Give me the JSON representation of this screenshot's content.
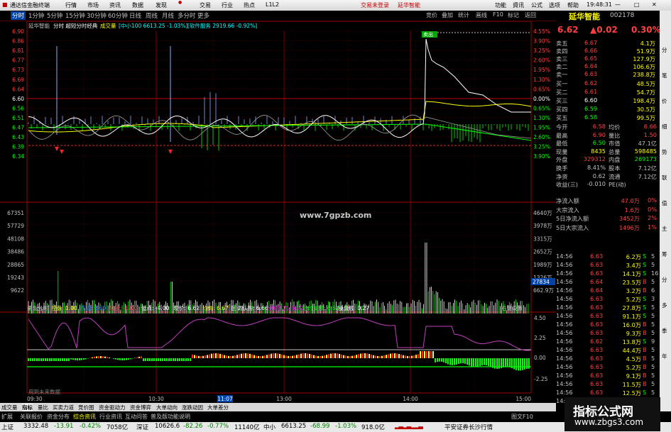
{
  "titlebar": {
    "app": "通达信金融终端",
    "menus": [
      "行情",
      "市场",
      "资讯",
      "数据",
      "发现",
      "交易",
      "行业",
      "热点",
      "L1L2"
    ],
    "trade_links": [
      "交易未登录",
      "延华智能"
    ],
    "right_menus": [
      "功能",
      "資讯",
      "公式",
      "选项",
      "帮助"
    ],
    "time": "19:48:31"
  },
  "tabs": {
    "periods": [
      "分时",
      "1分钟",
      "5分钟",
      "15分钟",
      "30分钟",
      "60分钟",
      "日线",
      "周线",
      "月线",
      "多分时",
      "更多"
    ],
    "active": "分时",
    "buttons": [
      "竞价",
      "叠加",
      "统计",
      "画线",
      "F10",
      "标记",
      "返回"
    ]
  },
  "chart": {
    "header": {
      "name": "延华智能",
      "mode": "分时 超短分时经典",
      "vol_label": "成交量",
      "index_info": "[中小100 6613.25 -1.03%]",
      "sector_info": "[软件服务 2919.66 -0.92%]"
    },
    "price_ticks": [
      "6.90",
      "6.86",
      "6.81",
      "6.77",
      "6.73",
      "6.69",
      "6.64",
      "6.60",
      "6.56",
      "6.51",
      "6.47",
      "6.43",
      "6.39",
      "6.34"
    ],
    "pct_ticks": [
      "4.55%",
      "3.90%",
      "3.25%",
      "2.60%",
      "1.95%",
      "1.30%",
      "0.65%",
      "0.00%",
      "0.65%",
      "1.30%",
      "1.95%",
      "2.60%",
      "3.25%",
      "3.90%"
    ],
    "vol_ticks": [
      "67351",
      "57729",
      "48108",
      "38486",
      "28865",
      "19243",
      "9622"
    ],
    "vol_right_ticks": [
      "4640万",
      "3978万",
      "3315万",
      "2652万",
      "1989万",
      "1326万",
      "662.9万"
    ],
    "vol_highlight": "27834",
    "watermark": "www.7gpzb.com",
    "marker_label": "卖出",
    "indicator": {
      "name": "量能分时",
      "items": [
        {
          "label": "控盘: 1.00",
          "color": "#ffff00"
        },
        {
          "label": "底点: 5.00",
          "color": "#0080ff"
        },
        {
          "label": "风险: -1.00",
          "color": "#ff4040"
        },
        {
          "label": "低点: -4.00",
          "color": "#ffffff"
        },
        {
          "label": "现价: 6.62",
          "color": "#ffffff"
        },
        {
          "label": "均价: 6.67",
          "color": "#ffff00"
        },
        {
          "label": "回调认购: 6.66",
          "color": "#ffffff"
        },
        {
          "label": "分时压力: 6.71",
          "color": "#ff00ff"
        },
        {
          "label": "分时支撑: 6.62",
          "color": "#00ff00"
        },
        {
          "label": "操盘线: 0.27",
          "color": "#ffffff"
        }
      ],
      "settings": "右键设置",
      "ticks": [
        "4.50",
        "2.25",
        "0.00",
        "-2.25"
      ],
      "footnote": "用到未来数据"
    },
    "time_ticks": [
      "09:30",
      "10:30",
      "11:07",
      "13:00",
      "14:00",
      "15:00"
    ]
  },
  "bottom_tabs": [
    "成交量",
    "指标",
    "量比",
    "买卖力道",
    "竞价图",
    "资金驱动力",
    "资金博弈",
    "大单动向",
    "涨跌动因",
    "大单差分"
  ],
  "bottom_links": [
    "扩展",
    "关联报价",
    "资金分布",
    "综合资讯",
    "行业资讯",
    "互动问答",
    "普及版功能说明"
  ],
  "status": {
    "sh": {
      "name": "上证",
      "value": "3332.48",
      "chg": "-13.91",
      "pct": "-0.42%",
      "amt": "7058亿"
    },
    "sz": {
      "name": "深证",
      "value": "10626.6",
      "chg": "-82.26",
      "pct": "-0.77%",
      "amt": "11140亿"
    },
    "zx": {
      "name": "中小",
      "value": "6613.25",
      "chg": "-68.99",
      "pct": "-1.03%",
      "amt": "918.0亿"
    },
    "broker": "平安证券长沙行情",
    "f10": "图文F10"
  },
  "quote": {
    "name": "延华智能",
    "code": "002178",
    "price": "6.62",
    "chg": "▲0.02",
    "pct": "0.30%",
    "asks": [
      {
        "label": "卖五",
        "price": "6.67",
        "vol": "4.1万"
      },
      {
        "label": "卖四",
        "price": "6.66",
        "vol": "51.9万"
      },
      {
        "label": "卖三",
        "price": "6.65",
        "vol": "127.9万"
      },
      {
        "label": "卖二",
        "price": "6.64",
        "vol": "106.6万"
      },
      {
        "label": "卖一",
        "price": "6.63",
        "vol": "238.8万"
      }
    ],
    "bids": [
      {
        "label": "买一",
        "price": "6.62",
        "vol": "48.5万"
      },
      {
        "label": "买二",
        "price": "6.61",
        "vol": "54.7万"
      },
      {
        "label": "买三",
        "price": "6.60",
        "vol": "198.4万"
      },
      {
        "label": "买四",
        "price": "6.59",
        "vol": "30.5万"
      },
      {
        "label": "买五",
        "price": "6.58",
        "vol": "99.5万"
      }
    ],
    "stats": [
      {
        "l1": "今开",
        "v1": "6.58",
        "c1": "#ff4040",
        "l2": "均价",
        "v2": "6.66",
        "c2": "#ff4040"
      },
      {
        "l1": "最高",
        "v1": "6.90",
        "c1": "#ff4040",
        "l2": "量比",
        "v2": "1.50",
        "c2": "#ff4040"
      },
      {
        "l1": "最低",
        "v1": "6.50",
        "c1": "#00ff00",
        "l2": "市值",
        "v2": "47.1亿",
        "c2": "#c0c0c0"
      },
      {
        "l1": "现量",
        "v1": "8435",
        "c1": "#ffff00",
        "l2": "总量",
        "v2": "598485",
        "c2": "#ffff00"
      },
      {
        "l1": "外盘",
        "v1": "329312",
        "c1": "#ff4040",
        "l2": "内盘",
        "v2": "269173",
        "c2": "#00ff00"
      },
      {
        "l1": "换手",
        "v1": "8.41%",
        "c1": "#c0c0c0",
        "l2": "股本",
        "v2": "7.12亿",
        "c2": "#c0c0c0"
      },
      {
        "l1": "净资",
        "v1": "0.62",
        "c1": "#c0c0c0",
        "l2": "流通",
        "v2": "7.12亿",
        "c2": "#c0c0c0"
      },
      {
        "l1": "收益(三)",
        "v1": "-0.010",
        "c1": "#c0c0c0",
        "l2": "PE(动)",
        "v2": "",
        "c2": "#c0c0c0"
      }
    ],
    "flows": [
      {
        "label": "净流入额",
        "value": "47.0万",
        "pct": "0%"
      },
      {
        "label": "大宗流入",
        "value": "1.6万",
        "pct": "0%"
      },
      {
        "label": "5日净流入额",
        "value": "3452万",
        "pct": "2%"
      },
      {
        "label": "5日大宗流入",
        "value": "1496万",
        "pct": "1%"
      }
    ],
    "ticks": [
      {
        "t": "14:56",
        "p": "6.63",
        "v": "6.2万",
        "d": "S",
        "n": "5"
      },
      {
        "t": "14:56",
        "p": "6.63",
        "v": "3.4万",
        "d": "S",
        "n": "5"
      },
      {
        "t": "14:56",
        "p": "6.63",
        "v": "14.1万",
        "d": "S",
        "n": "16"
      },
      {
        "t": "14:56",
        "p": "6.64",
        "v": "23.5万",
        "d": "B",
        "n": "5"
      },
      {
        "t": "14:56",
        "p": "6.64",
        "v": "3.2万",
        "d": "B",
        "n": "6"
      },
      {
        "t": "14:56",
        "p": "6.63",
        "v": "5.2万",
        "d": "S",
        "n": "3"
      },
      {
        "t": "14:56",
        "p": "6.63",
        "v": "27.8万",
        "d": "S",
        "n": "5"
      },
      {
        "t": "14:56",
        "p": "6.63",
        "v": "91.1万",
        "d": "S",
        "n": "5"
      },
      {
        "t": "14:56",
        "p": "6.63",
        "v": "16.0万",
        "d": "B",
        "n": "5"
      },
      {
        "t": "14:56",
        "p": "6.63",
        "v": "9.3万",
        "d": "B",
        "n": "5"
      },
      {
        "t": "14:56",
        "p": "6.62",
        "v": "13.8万",
        "d": "S",
        "n": "9"
      },
      {
        "t": "14:56",
        "p": "6.63",
        "v": "44.4万",
        "d": "B",
        "n": "5"
      },
      {
        "t": "14:56",
        "p": "6.63",
        "v": "4.5万",
        "d": "B",
        "n": "5"
      },
      {
        "t": "14:56",
        "p": "6.63",
        "v": "5.2万",
        "d": "B",
        "n": "5"
      },
      {
        "t": "14:56",
        "p": "6.63",
        "v": "9.1万",
        "d": "B",
        "n": "5"
      },
      {
        "t": "14:56",
        "p": "6.63",
        "v": "11.5万",
        "d": "B",
        "n": "5"
      },
      {
        "t": "14:56",
        "p": "6.63",
        "v": "12.5万",
        "d": "S",
        "n": "5"
      },
      {
        "t": "14:56",
        "p": "6.63",
        "v": "3.7万",
        "d": "B",
        "n": "5"
      }
    ],
    "sidebar": [
      "分",
      "笔",
      "价",
      "细",
      "势",
      "联",
      "值",
      "主",
      "筹",
      "分",
      "多",
      "季",
      "年"
    ]
  },
  "watermark_brand": {
    "line1": "指标公式网",
    "line2": "www.zbgs3.com"
  }
}
